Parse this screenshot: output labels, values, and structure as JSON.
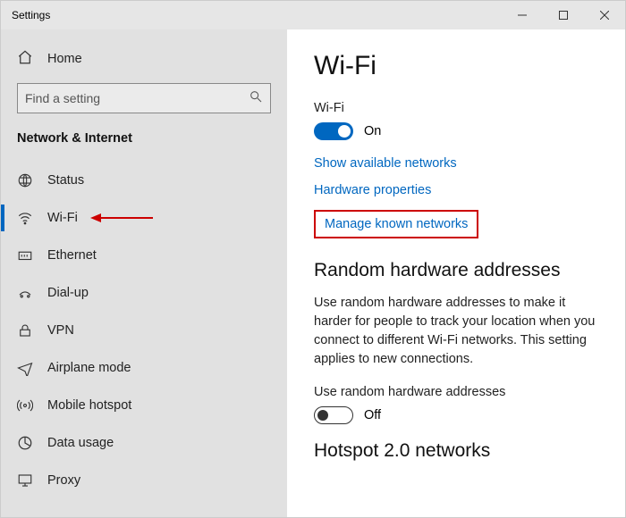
{
  "window": {
    "title": "Settings"
  },
  "sidebar": {
    "home_label": "Home",
    "search_placeholder": "Find a setting",
    "category": "Network & Internet",
    "items": [
      {
        "label": "Status",
        "icon": "status-icon"
      },
      {
        "label": "Wi-Fi",
        "icon": "wifi-icon"
      },
      {
        "label": "Ethernet",
        "icon": "ethernet-icon"
      },
      {
        "label": "Dial-up",
        "icon": "dialup-icon"
      },
      {
        "label": "VPN",
        "icon": "vpn-icon"
      },
      {
        "label": "Airplane mode",
        "icon": "airplane-icon"
      },
      {
        "label": "Mobile hotspot",
        "icon": "hotspot-icon"
      },
      {
        "label": "Data usage",
        "icon": "datausage-icon"
      },
      {
        "label": "Proxy",
        "icon": "proxy-icon"
      }
    ]
  },
  "content": {
    "title": "Wi-Fi",
    "wifi_label": "Wi-Fi",
    "wifi_state": "On",
    "link_show_available": "Show available networks",
    "link_hardware_props": "Hardware properties",
    "link_manage_known": "Manage known networks",
    "random_heading": "Random hardware addresses",
    "random_desc": "Use random hardware addresses to make it harder for people to track your location when you connect to different Wi-Fi networks. This setting applies to new connections.",
    "random_toggle_label": "Use random hardware addresses",
    "random_state": "Off",
    "hotspot_heading": "Hotspot 2.0 networks"
  }
}
